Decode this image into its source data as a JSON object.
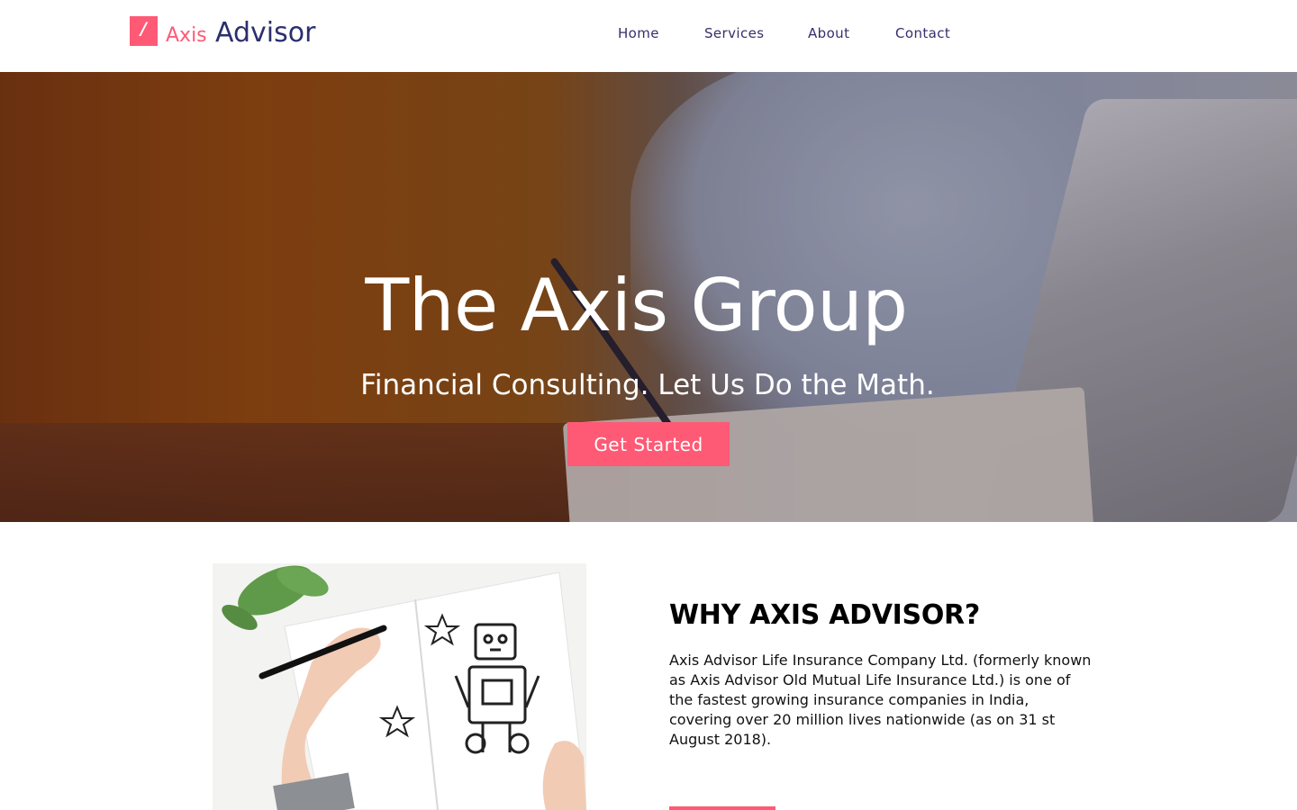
{
  "brand": {
    "mark": "/",
    "name_part1": "Axis",
    "name_part2": "Advisor"
  },
  "nav": {
    "items": [
      {
        "label": "Home"
      },
      {
        "label": "Services"
      },
      {
        "label": "About"
      },
      {
        "label": "Contact"
      }
    ]
  },
  "hero": {
    "title": "The Axis Group",
    "subtitle": "Financial Consulting. Let Us Do the Math.",
    "cta_label": "Get Started"
  },
  "why": {
    "heading": "WHY AXIS ADVISOR?",
    "body": "Axis Advisor Life Insurance Company Ltd. (formerly known as Axis Advisor Old Mutual Life Insurance Ltd.) is one of the fastest growing insurance companies in India, covering over 20 million lives nationwide (as on 31 st August 2018).",
    "image_icon": "robot-sketch-image"
  },
  "colors": {
    "accent": "#fe5a75",
    "brand_navy": "#2b2f6e",
    "nav_text": "#3a2d6b"
  }
}
